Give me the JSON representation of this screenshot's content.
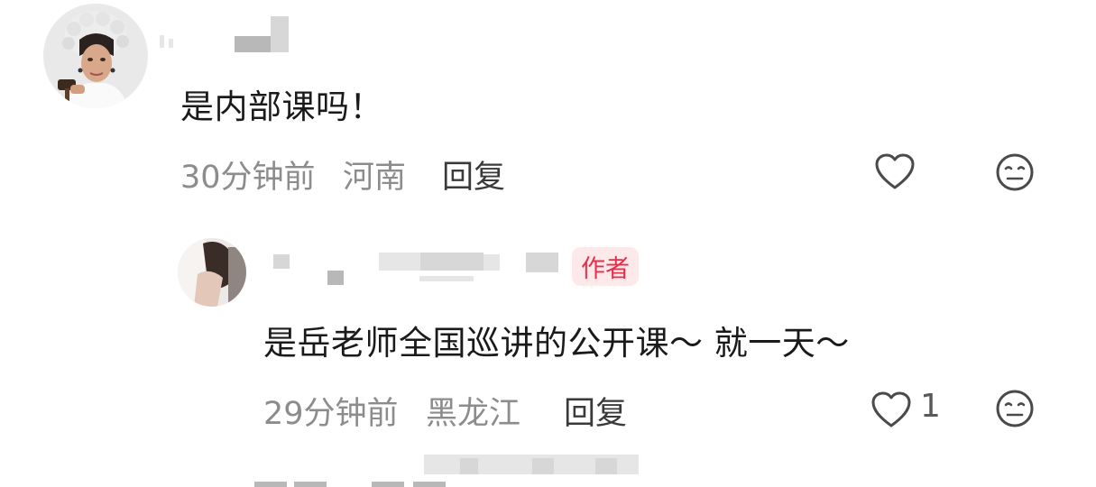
{
  "comments": [
    {
      "text": "是内部课吗！",
      "time": "30分钟前",
      "location": "河南",
      "reply_label": "回复",
      "like_count": null,
      "replies": [
        {
          "author_badge": "作者",
          "text": "是岳老师全国巡讲的公开课～ 就一天～",
          "time": "29分钟前",
          "location": "黑龙江",
          "reply_label": "回复",
          "like_count": "1"
        }
      ]
    }
  ],
  "icons": {
    "like": "heart-outline-icon",
    "dislike": "neutral-face-icon"
  },
  "colors": {
    "badge_bg": "#fde8ea",
    "badge_text": "#e5304a",
    "meta_text": "#8c8c8c"
  }
}
